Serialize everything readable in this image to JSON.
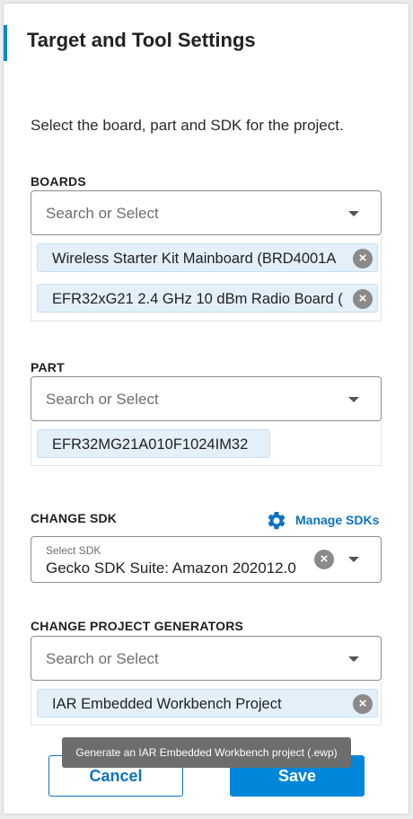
{
  "header": {
    "title": "Target and Tool Settings"
  },
  "description": "Select the board, part and SDK for the project.",
  "boards": {
    "label": "BOARDS",
    "placeholder": "Search or Select",
    "selected": [
      "Wireless Starter Kit Mainboard (BRD4001A",
      "EFR32xG21 2.4 GHz 10 dBm Radio Board ("
    ]
  },
  "part": {
    "label": "PART",
    "placeholder": "Search or Select",
    "selected": [
      "EFR32MG21A010F1024IM32"
    ]
  },
  "sdk": {
    "label": "CHANGE SDK",
    "manage_label": "Manage SDKs",
    "field_label": "Select SDK",
    "value": "Gecko SDK Suite: Amazon 202012.0"
  },
  "generators": {
    "label": "CHANGE PROJECT GENERATORS",
    "placeholder": "Search or Select",
    "selected": [
      "IAR Embedded Workbench Project"
    ]
  },
  "tooltip": "Generate an IAR Embedded Workbench project (.ewp)",
  "actions": {
    "cancel": "Cancel",
    "save": "Save"
  },
  "colors": {
    "accent": "#0086d9",
    "link": "#0b72c4",
    "chip_bg": "#e3f0fa"
  }
}
